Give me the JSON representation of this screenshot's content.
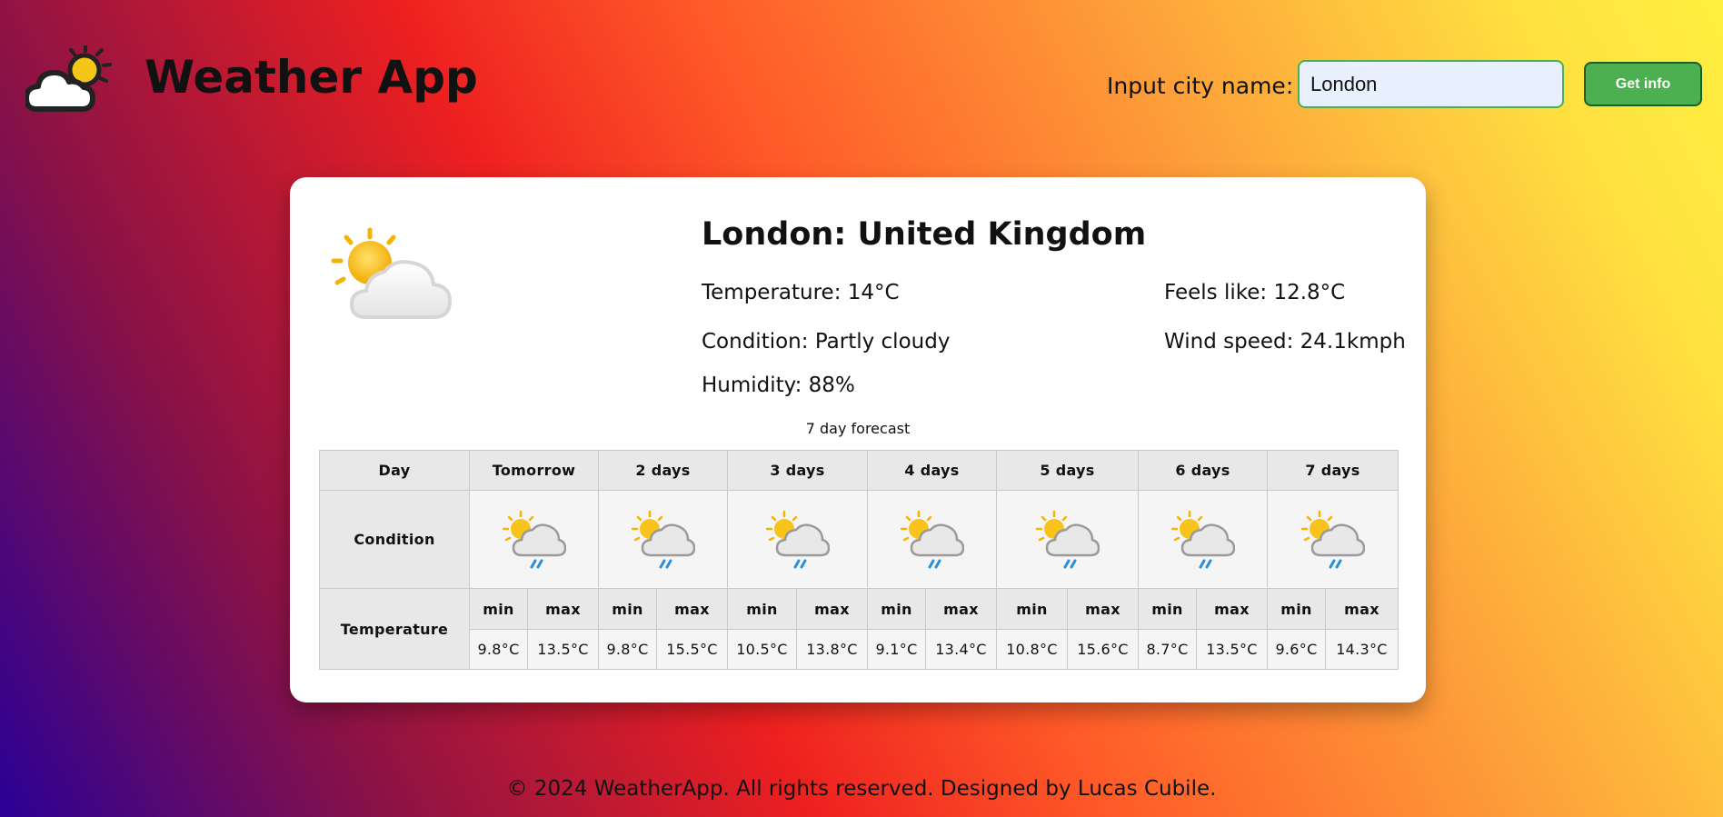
{
  "header": {
    "app_title": "Weather App",
    "city_label": "Input city name:",
    "city_input_value": "London",
    "button_label": "Get info"
  },
  "current": {
    "location": "London: United Kingdom",
    "temperature": "Temperature: 14°C",
    "feels_like": "Feels like: 12.8°C",
    "condition": "Condition: Partly cloudy",
    "wind_speed": "Wind speed: 24.1kmph",
    "humidity": "Humidity: 88%",
    "icon": "partly-cloudy-icon"
  },
  "forecast": {
    "caption": "7 day forecast",
    "row_labels": {
      "day": "Day",
      "condition": "Condition",
      "temperature": "Temperature"
    },
    "min_label": "min",
    "max_label": "max",
    "days": [
      {
        "label": "Tomorrow",
        "icon": "light-rain-icon",
        "min": "9.8°C",
        "max": "13.5°C"
      },
      {
        "label": "2 days",
        "icon": "light-rain-icon",
        "min": "9.8°C",
        "max": "15.5°C"
      },
      {
        "label": "3 days",
        "icon": "light-rain-icon",
        "min": "10.5°C",
        "max": "13.8°C"
      },
      {
        "label": "4 days",
        "icon": "light-rain-icon",
        "min": "9.1°C",
        "max": "13.4°C"
      },
      {
        "label": "5 days",
        "icon": "light-rain-icon",
        "min": "10.8°C",
        "max": "15.6°C"
      },
      {
        "label": "6 days",
        "icon": "light-rain-icon",
        "min": "8.7°C",
        "max": "13.5°C"
      },
      {
        "label": "7 days",
        "icon": "light-rain-icon",
        "min": "9.6°C",
        "max": "14.3°C"
      }
    ]
  },
  "footer": {
    "text": "© 2024 WeatherApp. All rights reserved. Designed by Lucas Cubile."
  },
  "colors": {
    "button": "#4caf50",
    "input_border": "#4cae4c",
    "input_bg": "#e8f0fe",
    "card": "#ffffff"
  }
}
